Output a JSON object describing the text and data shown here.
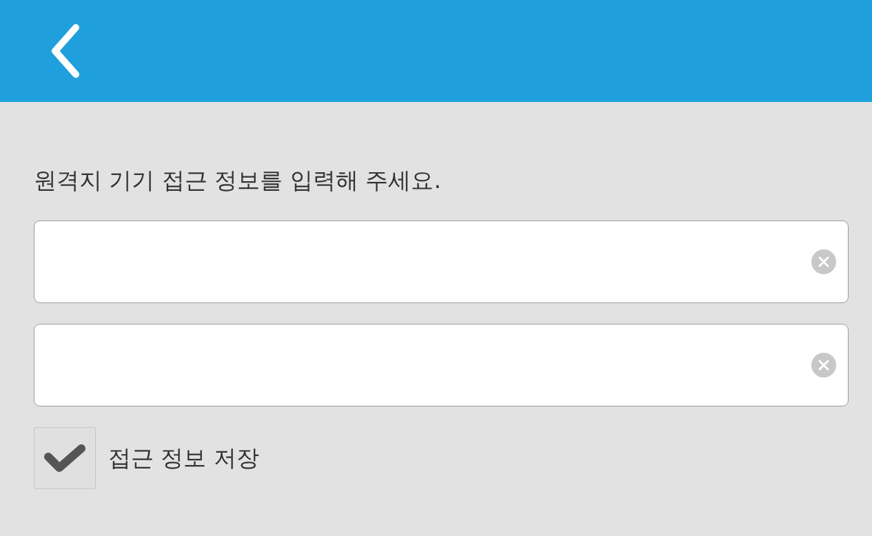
{
  "header": {
    "back_button": true
  },
  "instruction": "원격지 기기 접근 정보를 입력해 주세요.",
  "fields": [
    {
      "clearable": true
    },
    {
      "clearable": true
    }
  ],
  "save_access": {
    "label": "접근 정보 저장",
    "checked": true
  }
}
